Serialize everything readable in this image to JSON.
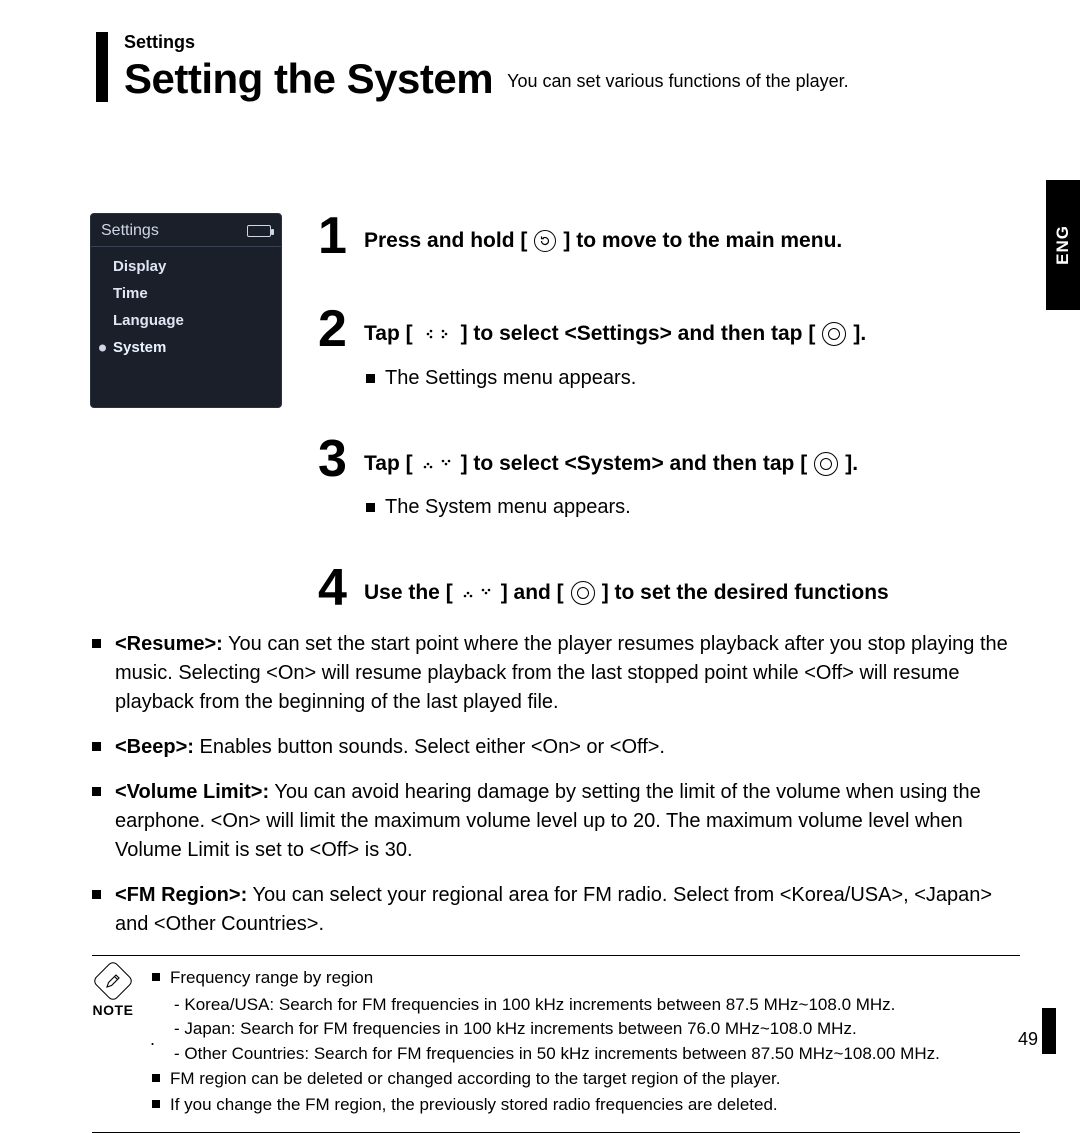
{
  "header": {
    "crumb": "Settings",
    "title": "Setting the System",
    "subtitle": "You can set various functions of the player."
  },
  "lang_tab": "ENG",
  "device": {
    "title": "Settings",
    "items": [
      "Display",
      "Time",
      "Language",
      "System"
    ],
    "active_index": 3
  },
  "steps": {
    "s1": {
      "num": "1",
      "a": "Press and hold [",
      "b": "] to move to the main menu."
    },
    "s2": {
      "num": "2",
      "a": "Tap [",
      "b": "] to select <Settings> and then tap [",
      "c": "].",
      "sub": "The Settings menu appears."
    },
    "s3": {
      "num": "3",
      "a": "Tap [",
      "b": "] to select <System> and then tap [",
      "c": "].",
      "sub": "The System menu appears."
    },
    "s4": {
      "num": "4",
      "a": "Use the [",
      "b": "] and [",
      "c": "] to set the desired functions"
    }
  },
  "options": {
    "resume": {
      "k": "<Resume>:",
      "v": "You can set the start point where the player resumes playback after you stop playing the music. Selecting <On> will resume playback from the last stopped point while <Off> will resume playback from the beginning of the last played file."
    },
    "beep": {
      "k": "<Beep>:",
      "v": "Enables button sounds. Select either <On> or <Off>."
    },
    "vol": {
      "k": "<Volume Limit>:",
      "v": "You can avoid hearing damage by setting the limit of the volume when using the earphone. <On> will limit the maximum volume level up to 20. The maximum volume level when Volume Limit is set to <Off> is 30."
    },
    "fm": {
      "k": "<FM Region>:",
      "v": "You can select your regional area for FM radio. Select from  <Korea/USA>, <Japan> and <Other Countries>."
    }
  },
  "note": {
    "label": "NOTE",
    "l1": "Frequency range by region",
    "l1a": "- Korea/USA: Search for FM frequencies in 100 kHz increments between 87.5 MHz~108.0 MHz.",
    "l1b": "- Japan: Search for FM frequencies in 100 kHz increments between 76.0 MHz~108.0 MHz.",
    "l1c": "- Other Countries: Search for FM frequencies in 50 kHz increments between 87.50 MHz~108.00 MHz.",
    "l2": "FM region can be deleted or changed according to the target region of the player.",
    "l3": "If you change the FM region, the previously stored radio frequencies are deleted."
  },
  "page_number": "49"
}
